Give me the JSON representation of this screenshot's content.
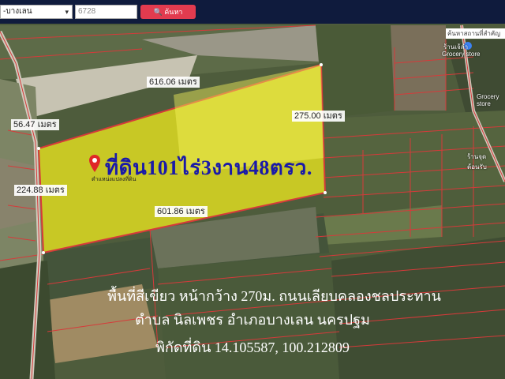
{
  "toolbar": {
    "province_select": "-บางเลน",
    "search_value": "6728",
    "search_button": "ค้นหา"
  },
  "map": {
    "measurements": {
      "top": "616.06 เมตร",
      "left_upper": "56.47 เมตร",
      "right": "275.00 เมตร",
      "left_lower": "224.88 เมตร",
      "bottom": "601.86 เมตร"
    },
    "poi_search_label": "ค้นหาสถานที่สำคัญ",
    "poi_1": "ร้านเจ้ลำ",
    "poi_1_sub": "Grocery store",
    "poi_2": "Grocery store",
    "poi_3": "ร้านจุดต้อนรับ"
  },
  "listing": {
    "title": "ที่ดิน101ไร่3งาน48ตรว.",
    "pin_label": "ตำแหน่งแปลงที่ดิน",
    "line1": "พื้นที่สีเขียว หน้ากว้าง 270ม. ถนนเลียบคลองชลประทาน",
    "line2": "ตำบล นิลเพชร อำเภอบางเลน นครปฐม",
    "line3": "พิกัดที่ดิน 14.105587, 100.212809"
  },
  "colors": {
    "parcel_fill": "#f2ec1e",
    "boundary": "#d63a3a",
    "title_text": "#1a1aa8"
  }
}
